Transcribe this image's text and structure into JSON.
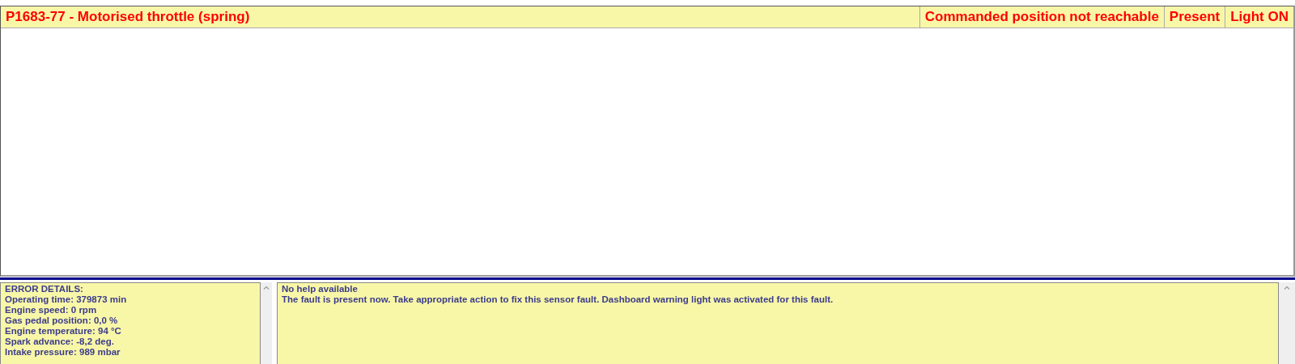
{
  "fault": {
    "code_title": "P1683-77 - Motorised throttle (spring)",
    "description": "Commanded position not reachable",
    "status": "Present",
    "light": "Light ON"
  },
  "error_details": {
    "heading": "ERROR DETAILS:",
    "lines": [
      "Operating time: 379873 min",
      "Engine speed: 0 rpm",
      "Gas pedal position: 0,0 %",
      "Engine temperature: 94 °C",
      "Spark advance: -8,2 deg.",
      "Intake pressure: 989 mbar"
    ]
  },
  "help": {
    "lines": [
      "No help available",
      "The fault is present now. Take appropriate action to fix this sensor fault. Dashboard warning light was activated for this fault."
    ]
  }
}
